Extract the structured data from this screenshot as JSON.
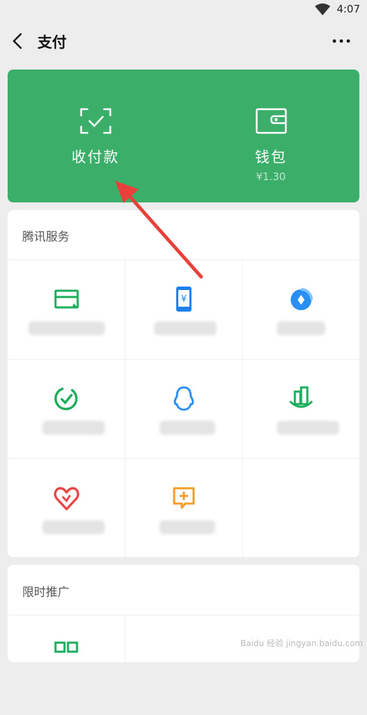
{
  "status": {
    "time": "4:07"
  },
  "header": {
    "title": "支付"
  },
  "pay_card": {
    "left_label": "收付款",
    "right_label": "钱包",
    "wallet_balance": "¥1.30"
  },
  "tencent_services": {
    "title": "腾讯服务",
    "items": [
      {
        "icon": "credit-card-repayment-icon"
      },
      {
        "icon": "phone-recharge-icon"
      },
      {
        "icon": "wealth-management-icon"
      },
      {
        "icon": "life-payment-icon"
      },
      {
        "icon": "qq-coin-recharge-icon"
      },
      {
        "icon": "city-services-icon"
      },
      {
        "icon": "charity-heart-icon"
      },
      {
        "icon": "medical-insurance-icon"
      }
    ]
  },
  "promotions": {
    "title": "限时推广",
    "items": [
      {
        "icon": "mini-program-icon"
      }
    ]
  },
  "watermark": "Baidu 经验 jingyan.baidu.com",
  "colors": {
    "brand_green": "#3bae6a",
    "arrow_red": "#e8403a"
  }
}
